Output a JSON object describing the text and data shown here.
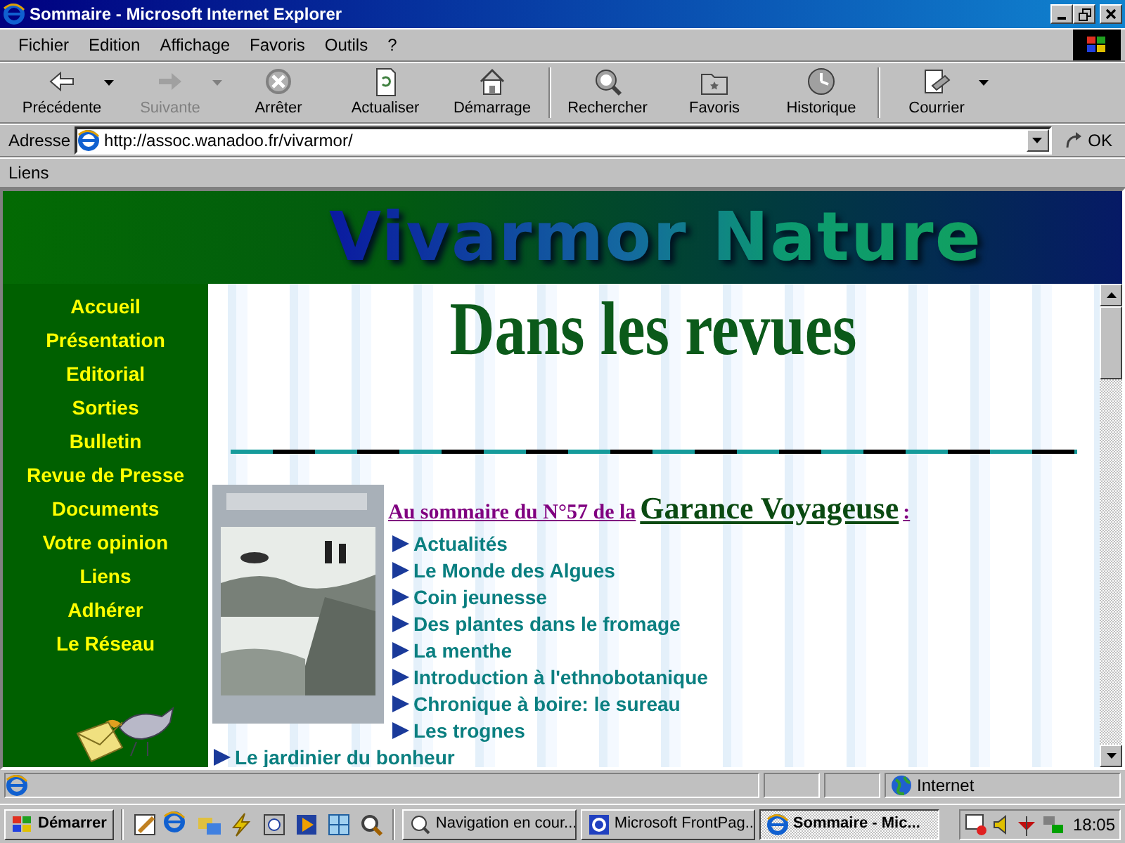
{
  "window": {
    "title": "Sommaire - Microsoft Internet Explorer"
  },
  "menu": [
    "Fichier",
    "Edition",
    "Affichage",
    "Favoris",
    "Outils",
    "?"
  ],
  "toolbar": [
    {
      "label": "Précédente",
      "disabled": false,
      "dropdown": true
    },
    {
      "label": "Suivante",
      "disabled": true,
      "dropdown": true
    },
    {
      "label": "Arrêter",
      "disabled": false,
      "dropdown": false
    },
    {
      "label": "Actualiser",
      "disabled": false,
      "dropdown": false
    },
    {
      "label": "Démarrage",
      "disabled": false,
      "dropdown": false
    },
    {
      "label": "Rechercher",
      "disabled": false,
      "dropdown": false
    },
    {
      "label": "Favoris",
      "disabled": false,
      "dropdown": false
    },
    {
      "label": "Historique",
      "disabled": false,
      "dropdown": false
    },
    {
      "label": "Courrier",
      "disabled": false,
      "dropdown": true
    }
  ],
  "address": {
    "label": "Adresse",
    "value": "http://assoc.wanadoo.fr/vivarmor/",
    "go": "OK"
  },
  "links_bar": {
    "label": "Liens"
  },
  "page": {
    "banner": "Vivarmor Nature",
    "sidebar": [
      "Accueil",
      "Présentation",
      "Editorial",
      "Sorties",
      "Bulletin",
      "Revue de Presse",
      "Documents",
      "Votre opinion",
      "Liens",
      "Adhérer",
      "Le Réseau"
    ],
    "heading": "Dans les revues",
    "summary": {
      "intro": "Au sommaire du N°57 de la",
      "magazine": "Garance Voyageuse",
      "colon": ":",
      "items": [
        "Actualités",
        "Le Monde des Algues",
        "Coin jeunesse",
        "Des plantes dans le fromage",
        "La menthe",
        "Introduction à l'ethnobotanique",
        "Chronique à boire: le sureau",
        "Les trognes"
      ]
    },
    "more_items": [
      "Le jardinier du bonheur"
    ]
  },
  "status_bar": {
    "zone": "Internet"
  },
  "taskbar": {
    "start": "Démarrer",
    "tasks": [
      {
        "label": "Navigation en cour...",
        "selected": false
      },
      {
        "label": "Microsoft FrontPag...",
        "selected": false
      },
      {
        "label": "Sommaire - Mic...",
        "selected": true
      }
    ],
    "clock": "18:05"
  }
}
